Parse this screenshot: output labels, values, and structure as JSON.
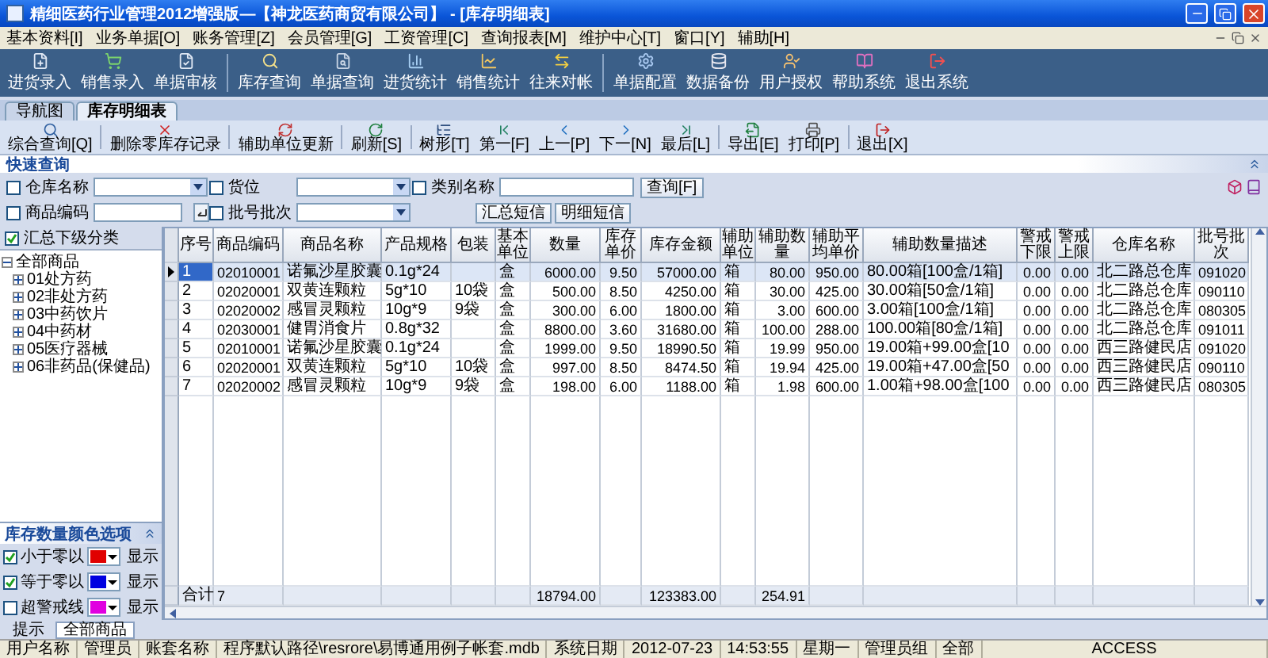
{
  "window": {
    "title": "精细医药行业管理2012增强版—【神龙医药商贸有限公司】 - [库存明细表]"
  },
  "menu": [
    "基本资料[I]",
    "业务单据[O]",
    "账务管理[Z]",
    "会员管理[G]",
    "工资管理[C]",
    "查询报表[M]",
    "维护中心[T]",
    "窗口[Y]",
    "辅助[H]"
  ],
  "toolbar": [
    {
      "label": "进货录入"
    },
    {
      "label": "销售录入"
    },
    {
      "label": "单据审核"
    },
    {
      "label": "库存查询"
    },
    {
      "label": "单据查询"
    },
    {
      "label": "进货统计"
    },
    {
      "label": "销售统计"
    },
    {
      "label": "往来对帐"
    },
    {
      "label": "单据配置"
    },
    {
      "label": "数据备份"
    },
    {
      "label": "用户授权"
    },
    {
      "label": "帮助系统"
    },
    {
      "label": "退出系统"
    }
  ],
  "tabs": [
    {
      "label": "导航图",
      "selected": false
    },
    {
      "label": "库存明细表",
      "selected": true
    }
  ],
  "actions": [
    {
      "label": "综合查询[Q]"
    },
    {
      "label": "删除零库存记录"
    },
    {
      "label": "辅助单位更新"
    },
    {
      "label": "刷新[S]"
    },
    {
      "label": "树形[T]"
    },
    {
      "label": "第一[F]"
    },
    {
      "label": "上一[P]"
    },
    {
      "label": "下一[N]"
    },
    {
      "label": "最后[L]"
    },
    {
      "label": "导出[E]"
    },
    {
      "label": "打印[P]"
    },
    {
      "label": "退出[X]"
    }
  ],
  "quick_query": {
    "title": "快速查询",
    "rows": [
      {
        "filters": [
          {
            "label": "仓库名称",
            "checked": false,
            "kind": "combo"
          },
          {
            "label": "货位",
            "checked": false,
            "kind": "combo"
          },
          {
            "label": "类别名称",
            "checked": false,
            "kind": "field"
          }
        ],
        "buttons": [
          {
            "label": "查询[F]"
          }
        ]
      },
      {
        "filters": [
          {
            "label": "商品编码",
            "checked": false,
            "kind": "picker"
          },
          {
            "label": "批号批次",
            "checked": false,
            "kind": "combo"
          }
        ],
        "buttons": [
          {
            "label": "汇总短信"
          },
          {
            "label": "明细短信"
          }
        ]
      }
    ]
  },
  "summary_option": {
    "label": "汇总下级分类",
    "checked": true
  },
  "category_tree": [
    {
      "label": "全部商品",
      "expanded": true,
      "children": [
        {
          "label": "01处方药",
          "expanded": false
        },
        {
          "label": "02非处方药",
          "expanded": false
        },
        {
          "label": "03中药饮片",
          "expanded": false
        },
        {
          "label": "04中药材",
          "expanded": false
        },
        {
          "label": "05医疗器械",
          "expanded": false
        },
        {
          "label": "06非药品(保健品)",
          "expanded": false
        }
      ]
    }
  ],
  "color_options": {
    "title": "库存数量颜色选项",
    "items": [
      {
        "label": "小于零以",
        "checked": true,
        "color": "#e00000",
        "suffix": "显示"
      },
      {
        "label": "等于零以",
        "checked": true,
        "color": "#0000e0",
        "suffix": "显示"
      },
      {
        "label": "超警戒线",
        "checked": false,
        "color": "#e000e0",
        "suffix": "显示"
      }
    ]
  },
  "table": {
    "columns": [
      "序号",
      "商品编码",
      "商品名称",
      "产品规格",
      "包装",
      "基本单位",
      "数量",
      "库存单价",
      "库存金额",
      "辅助单位",
      "辅助数量",
      "辅助平均单价",
      "辅助数量描述",
      "警戒下限",
      "警戒上限",
      "仓库名称",
      "批号批次"
    ],
    "rows": [
      {
        "selected": true,
        "no": "1",
        "code": "02010001",
        "name": "诺氟沙星胶囊",
        "spec": "0.1g*24",
        "unit": "盒",
        "quantity": "6000.00",
        "unit_price": "9.50",
        "amount": "57000.00",
        "aux_unit": "箱",
        "aux_quantity": "80.00",
        "aux_avg_price": "950.00",
        "aux_description": "80.00箱[100盒/1箱]",
        "alert_min": "0.00",
        "alert_max": "0.00",
        "warehouse": "北二路总仓库",
        "batch": "091020"
      },
      {
        "selected": false,
        "no": "2",
        "code": "02020001",
        "name": "双黄连颗粒",
        "spec": "5g*10",
        "package": "10袋",
        "unit": "盒",
        "quantity": "500.00",
        "unit_price": "8.50",
        "amount": "4250.00",
        "aux_unit": "箱",
        "aux_quantity": "30.00",
        "aux_avg_price": "425.00",
        "aux_description": "30.00箱[50盒/1箱]",
        "alert_min": "0.00",
        "alert_max": "0.00",
        "warehouse": "北二路总仓库",
        "batch": "090110"
      },
      {
        "selected": false,
        "no": "3",
        "code": "02020002",
        "name": "感冒灵颗粒",
        "spec": "10g*9",
        "package": "9袋",
        "unit": "盒",
        "quantity": "300.00",
        "unit_price": "6.00",
        "amount": "1800.00",
        "aux_unit": "箱",
        "aux_quantity": "3.00",
        "aux_avg_price": "600.00",
        "aux_description": "3.00箱[100盒/1箱]",
        "alert_min": "0.00",
        "alert_max": "0.00",
        "warehouse": "北二路总仓库",
        "batch": "080305"
      },
      {
        "selected": false,
        "no": "4",
        "code": "02030001",
        "name": "健胃消食片",
        "spec": "0.8g*32",
        "unit": "盒",
        "quantity": "8800.00",
        "unit_price": "3.60",
        "amount": "31680.00",
        "aux_unit": "箱",
        "aux_quantity": "100.00",
        "aux_avg_price": "288.00",
        "aux_description": "100.00箱[80盒/1箱]",
        "alert_min": "0.00",
        "alert_max": "0.00",
        "warehouse": "北二路总仓库",
        "batch": "091011"
      },
      {
        "selected": false,
        "no": "5",
        "code": "02010001",
        "name": "诺氟沙星胶囊",
        "spec": "0.1g*24",
        "unit": "盒",
        "quantity": "1999.00",
        "unit_price": "9.50",
        "amount": "18990.50",
        "aux_unit": "箱",
        "aux_quantity": "19.99",
        "aux_avg_price": "950.00",
        "aux_description": "19.00箱+99.00盒[10",
        "alert_min": "0.00",
        "alert_max": "0.00",
        "warehouse": "西三路健民店",
        "batch": "091020"
      },
      {
        "selected": false,
        "no": "6",
        "code": "02020001",
        "name": "双黄连颗粒",
        "spec": "5g*10",
        "package": "10袋",
        "unit": "盒",
        "quantity": "997.00",
        "unit_price": "8.50",
        "amount": "8474.50",
        "aux_unit": "箱",
        "aux_quantity": "19.94",
        "aux_avg_price": "425.00",
        "aux_description": "19.00箱+47.00盒[50",
        "alert_min": "0.00",
        "alert_max": "0.00",
        "warehouse": "西三路健民店",
        "batch": "090110"
      },
      {
        "selected": false,
        "no": "7",
        "code": "02020002",
        "name": "感冒灵颗粒",
        "spec": "10g*9",
        "package": "9袋",
        "unit": "盒",
        "quantity": "198.00",
        "unit_price": "6.00",
        "amount": "1188.00",
        "aux_unit": "箱",
        "aux_quantity": "1.98",
        "aux_avg_price": "600.00",
        "aux_description": "1.00箱+98.00盒[100",
        "alert_min": "0.00",
        "alert_max": "0.00",
        "warehouse": "西三路健民店",
        "batch": "080305"
      }
    ],
    "footer": {
      "label": "合计",
      "count": "7",
      "quantity": "18794.00",
      "amount": "123383.00",
      "aux_quantity": "254.91"
    }
  },
  "bottom_tabs": [
    {
      "label": "提示",
      "selected": false
    },
    {
      "label": "全部商品",
      "selected": true
    }
  ],
  "status_bar": [
    "用户名称",
    "管理员",
    "账套名称",
    "程序默认路径\\resrore\\易博通用例子帐套.mdb",
    "系统日期",
    "2012-07-23",
    "14:53:55",
    "星期一",
    "管理员组",
    "全部",
    "ACCESS"
  ]
}
